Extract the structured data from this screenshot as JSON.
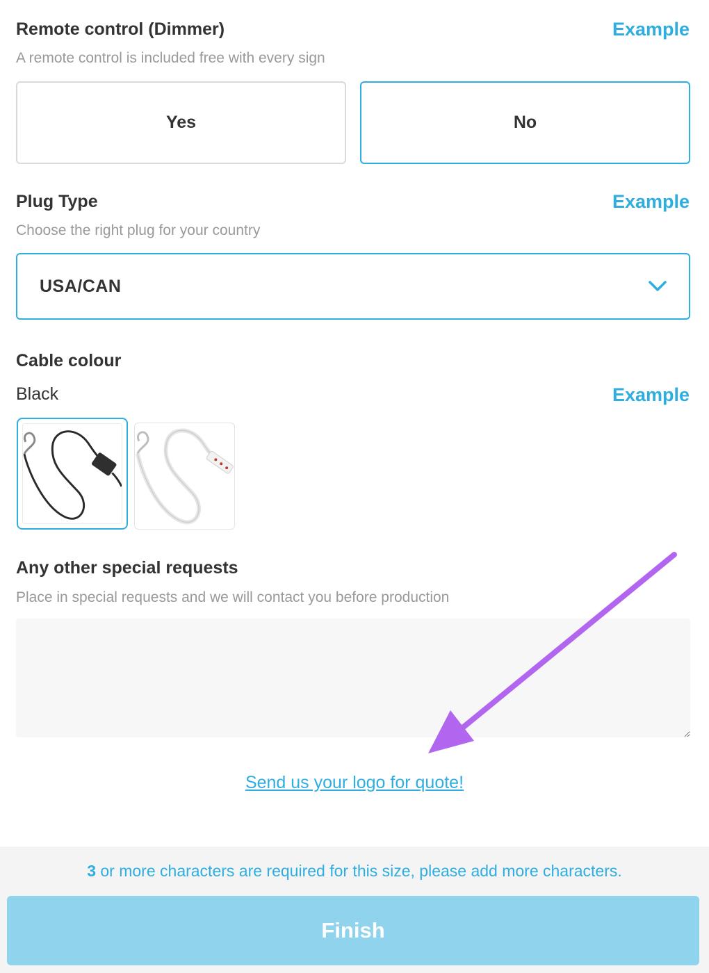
{
  "remote_control": {
    "title": "Remote control (Dimmer)",
    "example_label": "Example",
    "helper": "A remote control is included free with every sign",
    "options": [
      "Yes",
      "No"
    ],
    "selected": "No"
  },
  "plug_type": {
    "title": "Plug Type",
    "example_label": "Example",
    "helper": "Choose the right plug for your country",
    "selected": "USA/CAN"
  },
  "cable_colour": {
    "title": "Cable colour",
    "selected": "Black",
    "example_label": "Example",
    "swatches": [
      "black-cable",
      "white-cable"
    ]
  },
  "special_requests": {
    "title": "Any other special requests",
    "helper": "Place in special requests and we will contact you before production",
    "value": ""
  },
  "logo_link": "Send us your logo for quote!",
  "footer": {
    "required_count": "3",
    "message": " or more characters are required for this size, please add more characters.",
    "finish_label": "Finish"
  },
  "colors": {
    "accent": "#2eaee0",
    "finish_disabled": "#8fd4ec",
    "annotation_arrow": "#b266f0"
  }
}
